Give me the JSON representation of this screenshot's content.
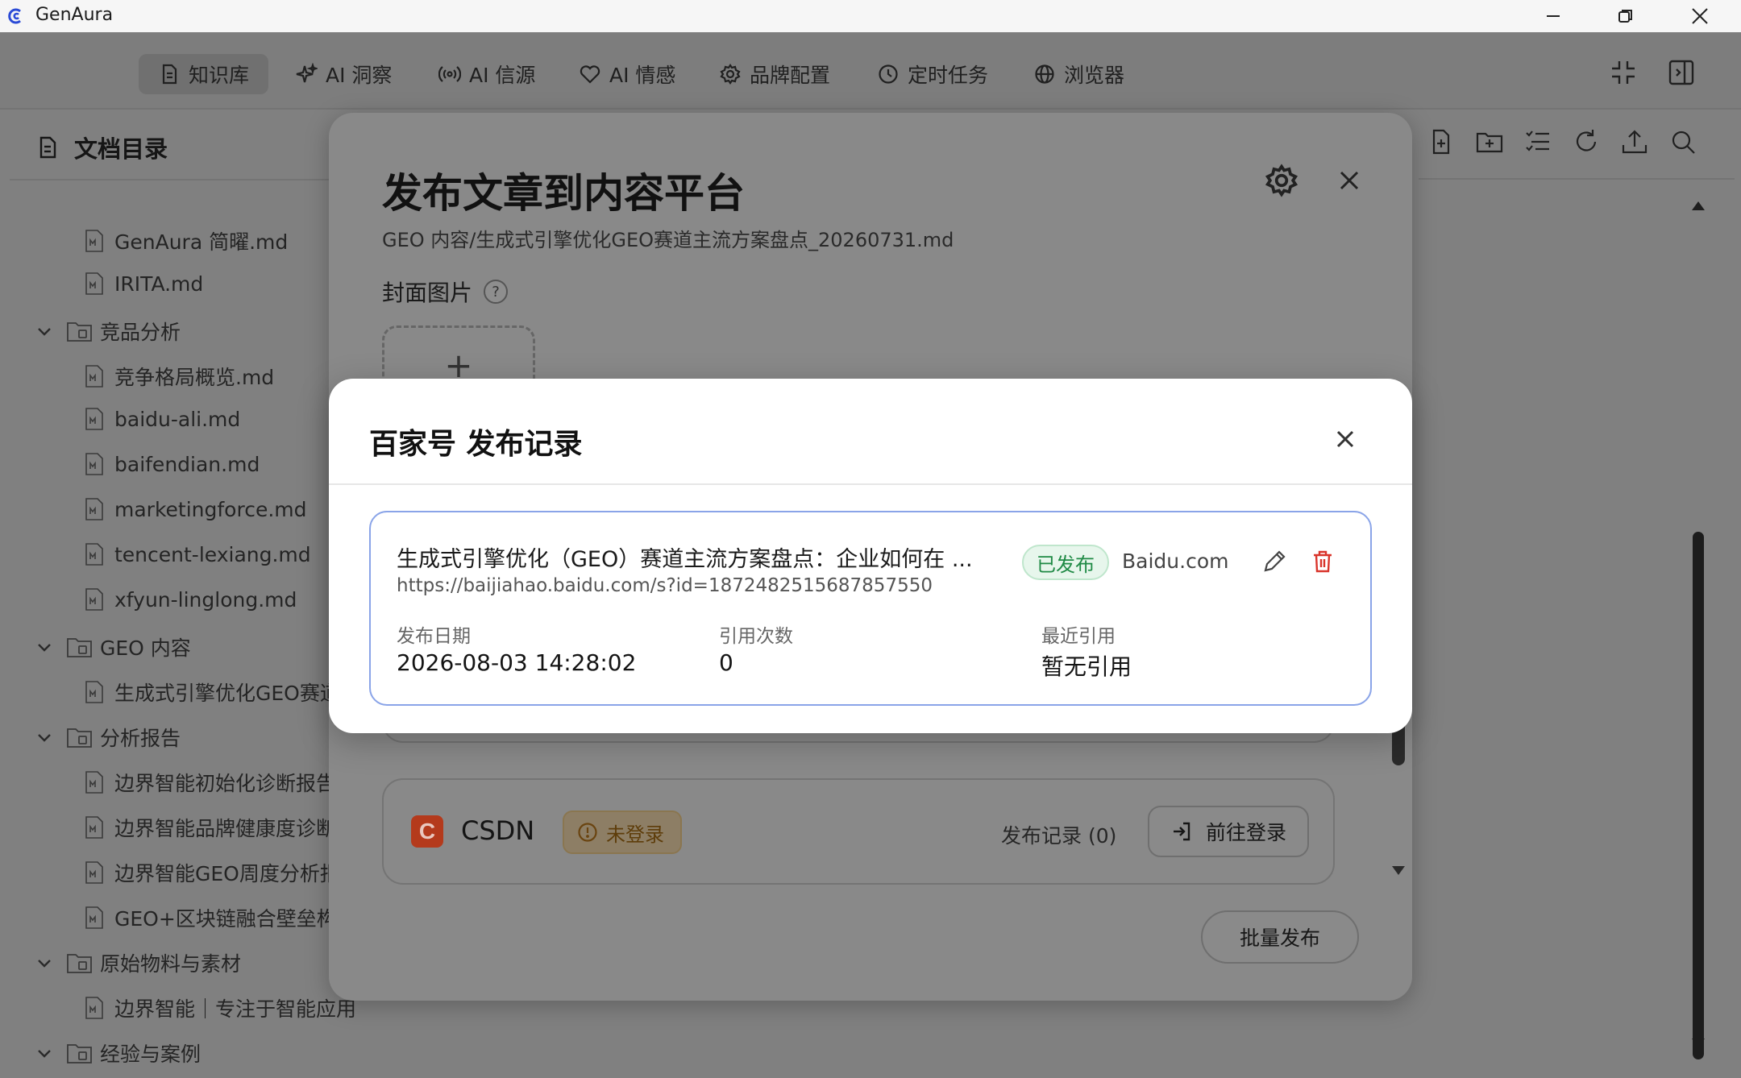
{
  "window": {
    "title": "GenAura"
  },
  "nav": {
    "items": [
      {
        "label": "知识库",
        "icon": "document-icon",
        "active": true
      },
      {
        "label": "AI 洞察",
        "icon": "sparkle-icon",
        "active": false
      },
      {
        "label": "AI 信源",
        "icon": "broadcast-icon",
        "active": false
      },
      {
        "label": "AI 情感",
        "icon": "heart-icon",
        "active": false
      },
      {
        "label": "品牌配置",
        "icon": "gear-icon",
        "active": false
      },
      {
        "label": "定时任务",
        "icon": "clock-icon",
        "active": false
      },
      {
        "label": "浏览器",
        "icon": "globe-icon",
        "active": false
      }
    ]
  },
  "sidebar": {
    "title": "文档目录",
    "tree": [
      {
        "label": "GenAura 简曜.md",
        "type": "file"
      },
      {
        "label": "IRITA.md",
        "type": "file"
      },
      {
        "label": "竞品分析",
        "type": "folder"
      },
      {
        "label": "竞争格局概览.md",
        "type": "file"
      },
      {
        "label": "baidu-ali.md",
        "type": "file"
      },
      {
        "label": "baifendian.md",
        "type": "file"
      },
      {
        "label": "marketingforce.md",
        "type": "file"
      },
      {
        "label": "tencent-lexiang.md",
        "type": "file"
      },
      {
        "label": "xfyun-linglong.md",
        "type": "file"
      },
      {
        "label": "GEO 内容",
        "type": "folder"
      },
      {
        "label": "生成式引擎优化GEO赛道",
        "type": "file"
      },
      {
        "label": "分析报告",
        "type": "folder"
      },
      {
        "label": "边界智能初始化诊断报告.",
        "type": "file"
      },
      {
        "label": "边界智能品牌健康度诊断",
        "type": "file"
      },
      {
        "label": "边界智能GEO周度分析报",
        "type": "file"
      },
      {
        "label": "GEO+区块链融合壁垒构筑",
        "type": "file"
      },
      {
        "label": "原始物料与素材",
        "type": "folder"
      },
      {
        "label": "边界智能｜专注于智能应用",
        "type": "file"
      },
      {
        "label": "经验与案例",
        "type": "folder"
      }
    ]
  },
  "publish_modal": {
    "title": "发布文章到内容平台",
    "path": "GEO 内容/生成式引擎优化GEO赛道主流方案盘点_20260731.md",
    "cover_label": "封面图片",
    "help": "?",
    "cover_add": "+",
    "platform": {
      "logo": "C",
      "name": "CSDN",
      "status": "未登录",
      "records": "发布记录 (0)",
      "login_button": "前往登录"
    },
    "batch_button": "批量发布"
  },
  "records_dialog": {
    "title": "百家号 发布记录",
    "record": {
      "title": "生成式引擎优化（GEO）赛道主流方案盘点：企业如何在 ...",
      "url": "https://baijiahao.baidu.com/s?id=1872482515687857550",
      "status": "已发布",
      "domain": "Baidu.com",
      "stats": [
        {
          "label": "发布日期",
          "value": "2026-08-03 14:28:02"
        },
        {
          "label": "引用次数",
          "value": "0"
        },
        {
          "label": "最近引用",
          "value": "暂无引用"
        }
      ]
    }
  },
  "colors": {
    "published_green": "#1f8a45",
    "delete_red": "#d9342b",
    "card_border_blue": "#8aa4e8",
    "csdn_brand": "#b43a1c"
  }
}
